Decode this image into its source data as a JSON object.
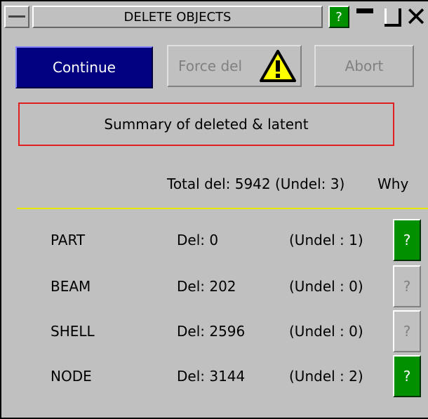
{
  "window": {
    "title": "DELETE OBJECTS",
    "help_label": "?"
  },
  "buttons": {
    "continue_label": "Continue",
    "force_label": "Force del",
    "abort_label": "Abort"
  },
  "summary": {
    "label": "Summary of deleted & latent",
    "total_text": "Total del: 5942 (Undel: 3)",
    "why_label": "Why"
  },
  "rows": [
    {
      "name": "PART",
      "del": "Del: 0",
      "undel": "(Undel : 1)",
      "q": "?",
      "active": true
    },
    {
      "name": "BEAM",
      "del": "Del: 202",
      "undel": "(Undel : 0)",
      "q": "?",
      "active": false
    },
    {
      "name": "SHELL",
      "del": "Del: 2596",
      "undel": "(Undel : 0)",
      "q": "?",
      "active": false
    },
    {
      "name": "NODE",
      "del": "Del: 3144",
      "undel": "(Undel : 2)",
      "q": "?",
      "active": true
    }
  ],
  "colors": {
    "window_bg": "#c0c0c0",
    "continue_bg": "#000080",
    "help_green": "#009000",
    "summary_border": "#e02020",
    "separator": "#e8e800",
    "warning_yellow": "#ffff00"
  },
  "icons": {
    "force_warning": "warning-triangle-icon"
  }
}
